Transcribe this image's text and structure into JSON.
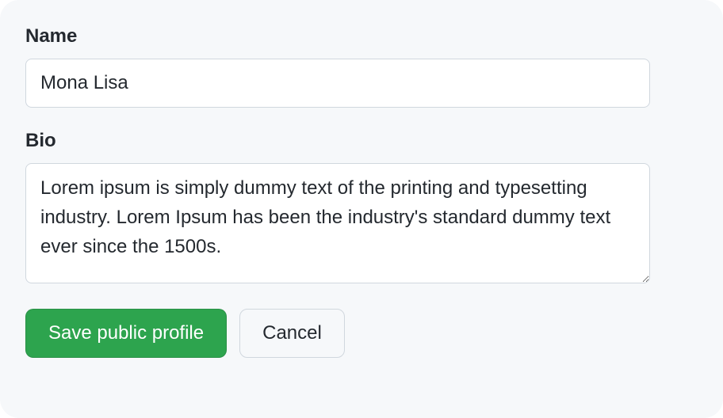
{
  "form": {
    "name": {
      "label": "Name",
      "value": "Mona Lisa"
    },
    "bio": {
      "label": "Bio",
      "value": "Lorem ipsum is simply dummy text of the printing and typesetting industry. Lorem Ipsum has been the industry's standard dummy text ever since the 1500s."
    }
  },
  "buttons": {
    "save": "Save public profile",
    "cancel": "Cancel"
  }
}
